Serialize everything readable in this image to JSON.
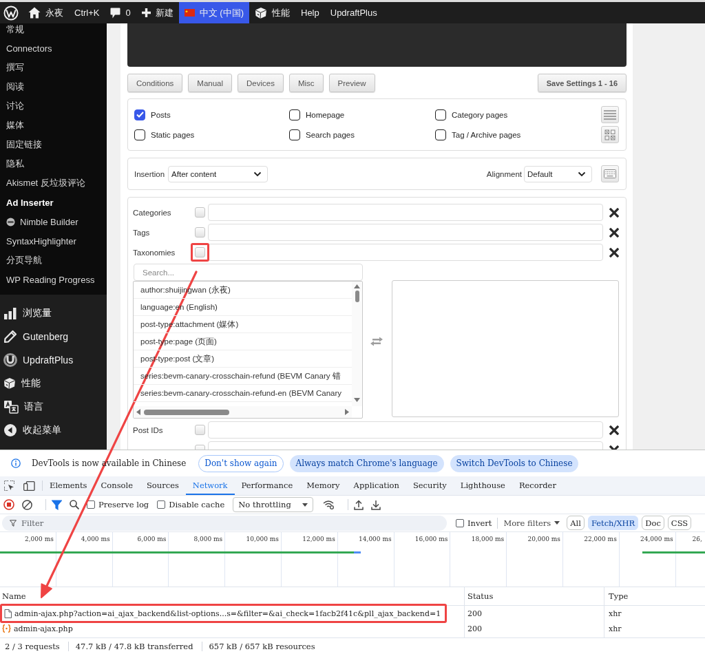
{
  "admin_bar": {
    "items": [
      {
        "kind": "wp-logo",
        "highlighted": false
      },
      {
        "kind": "home",
        "label": "永夜",
        "highlighted": false
      },
      {
        "kind": "text",
        "label": "Ctrl+K",
        "highlighted": false
      },
      {
        "kind": "comments",
        "label": "0",
        "highlighted": false
      },
      {
        "kind": "new",
        "label": "新建",
        "highlighted": false
      },
      {
        "kind": "flag",
        "label": "中文 (中国)",
        "highlighted": true
      },
      {
        "kind": "cube",
        "label": "性能",
        "highlighted": false
      },
      {
        "kind": "text",
        "label": "Help",
        "highlighted": false
      },
      {
        "kind": "text",
        "label": "UpdraftPlus",
        "highlighted": false
      }
    ]
  },
  "sidebar": {
    "submenu": [
      {
        "kind": "text",
        "label": "常规",
        "current": false
      },
      {
        "kind": "text",
        "label": "Connectors",
        "current": false
      },
      {
        "kind": "text",
        "label": "撰写",
        "current": false
      },
      {
        "kind": "text",
        "label": "阅读",
        "current": false
      },
      {
        "kind": "text",
        "label": "讨论",
        "current": false
      },
      {
        "kind": "text",
        "label": "媒体",
        "current": false
      },
      {
        "kind": "text",
        "label": "固定链接",
        "current": false
      },
      {
        "kind": "text",
        "label": "隐私",
        "current": false
      },
      {
        "kind": "text",
        "label": "Akismet 反垃圾评论",
        "current": false
      },
      {
        "kind": "text",
        "label": "Ad Inserter",
        "current": true
      },
      {
        "kind": "nimble",
        "label": "Nimble Builder",
        "current": false
      },
      {
        "kind": "text",
        "label": "SyntaxHighlighter",
        "current": false
      },
      {
        "kind": "text",
        "label": "分页导航",
        "current": false
      },
      {
        "kind": "text",
        "label": "WP Reading Progress",
        "current": false
      }
    ],
    "menu": [
      {
        "kind": "chart",
        "label": "浏览量"
      },
      {
        "kind": "pencil",
        "label": "Gutenberg"
      },
      {
        "kind": "updraft",
        "label": "UpdraftPlus"
      },
      {
        "kind": "cube",
        "label": "性能"
      },
      {
        "kind": "translate",
        "label": "语言"
      },
      {
        "kind": "collapse",
        "label": "收起菜单"
      }
    ]
  },
  "ad_inserter": {
    "tabs": [
      "Conditions",
      "Manual",
      "Devices",
      "Misc",
      "Preview"
    ],
    "save_button": "Save Settings 1 - 16",
    "page_types": [
      {
        "label": "Posts",
        "checked": true
      },
      {
        "label": "Homepage",
        "checked": false
      },
      {
        "label": "Category pages",
        "checked": false
      },
      {
        "label": "Static pages",
        "checked": false
      },
      {
        "label": "Search pages",
        "checked": false
      },
      {
        "label": "Tag / Archive pages",
        "checked": false
      }
    ],
    "insertion": {
      "label": "Insertion",
      "value": "After content"
    },
    "alignment": {
      "label": "Alignment",
      "value": "Default"
    },
    "lists": [
      {
        "kind": "field",
        "label": "Categories",
        "checked": false,
        "highlighted": false
      },
      {
        "kind": "field",
        "label": "Tags",
        "checked": false,
        "highlighted": false
      },
      {
        "kind": "field",
        "label": "Taxonomies",
        "checked": false,
        "highlighted": true
      },
      {
        "kind": "picker",
        "search": {
          "placeholder": "Search..."
        },
        "options": [
          "author:shuijingwan (永夜)",
          "language:en (English)",
          "post-type:attachment (媒体)",
          "post-type:page (页面)",
          "post-type:post (文章)",
          "series:bevm-canary-crosschain-refund (BEVM Canary 错",
          "series:bevm-canary-crosschain-refund-en (BEVM Canary"
        ]
      },
      {
        "kind": "field",
        "label": "Post IDs",
        "checked": false,
        "highlighted": false
      },
      {
        "kind": "field",
        "checked": false,
        "highlighted": false
      }
    ]
  },
  "devtools": {
    "infobar": {
      "message": "DevTools is now available in Chinese",
      "buttons": [
        {
          "kind": "outline",
          "label": "Don't show again"
        },
        {
          "kind": "filled",
          "label": "Always match Chrome's language"
        },
        {
          "kind": "filled",
          "label": "Switch DevTools to Chinese"
        }
      ]
    },
    "tabs": [
      {
        "label": "Elements",
        "selected": false
      },
      {
        "label": "Console",
        "selected": false
      },
      {
        "label": "Sources",
        "selected": false
      },
      {
        "label": "Network",
        "selected": true
      },
      {
        "label": "Performance",
        "selected": false
      },
      {
        "label": "Memory",
        "selected": false
      },
      {
        "label": "Application",
        "selected": false
      },
      {
        "label": "Security",
        "selected": false
      },
      {
        "label": "Lighthouse",
        "selected": false
      },
      {
        "label": "Recorder",
        "selected": false
      }
    ],
    "toolbar": {
      "recording": true,
      "filter_on": true,
      "checkboxes": [
        {
          "label": "Preserve log",
          "checked": false
        },
        {
          "label": "Disable cache",
          "checked": false
        }
      ],
      "throttling": "No throttling"
    },
    "filter_bar": {
      "placeholder": "Filter",
      "invert": {
        "label": "Invert",
        "checked": false
      },
      "more_filters": "More filters",
      "types": [
        {
          "label": "All",
          "selected": false
        },
        {
          "label": "Fetch/XHR",
          "selected": true
        },
        {
          "label": "Doc",
          "selected": false
        },
        {
          "label": "CSS",
          "selected": false
        }
      ]
    },
    "timeline": {
      "ticks": [
        "2,000 ms",
        "4,000 ms",
        "6,000 ms",
        "8,000 ms",
        "10,000 ms",
        "12,000 ms",
        "14,000 ms",
        "16,000 ms",
        "18,000 ms",
        "20,000 ms",
        "22,000 ms",
        "24,000 ms",
        "26,"
      ]
    },
    "table": {
      "columns": [
        "Name",
        "Status",
        "Type"
      ],
      "rows": [
        {
          "kind": "document",
          "name": "admin-ajax.php?action=ai_ajax_backend&list-options...s=&filter=&ai_check=1facb2f41c&pll_ajax_backend=1",
          "status": "200",
          "type": "xhr",
          "highlighted": true
        },
        {
          "kind": "fetch",
          "name": "admin-ajax.php",
          "status": "200",
          "type": "xhr",
          "highlighted": false
        }
      ]
    },
    "status_bar": [
      "2 / 3 requests",
      "47.7 kB / 47.8 kB transferred",
      "657 kB / 657 kB resources"
    ]
  }
}
